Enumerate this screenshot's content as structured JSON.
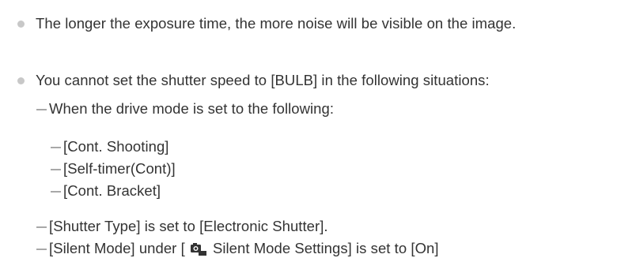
{
  "notes": {
    "note1": "The longer the exposure time, the more noise will be visible on the image.",
    "note2": "You cannot set the shutter speed to [BULB] in the following situations:",
    "sub1": "When the drive mode is set to the following:",
    "drive_modes": [
      "[Cont. Shooting]",
      "[Self-timer(Cont)]",
      "[Cont. Bracket]"
    ],
    "sub2": "[Shutter Type] is set to [Electronic Shutter].",
    "sub3_prefix": "[Silent Mode] under [",
    "sub3_icon": "camera-silent-mode-icon",
    "sub3_suffix": " Silent Mode Settings] is set to [On]"
  },
  "colors": {
    "text": "#333333",
    "bullet": "#c8c8c8",
    "dash": "#a8a8a8"
  }
}
